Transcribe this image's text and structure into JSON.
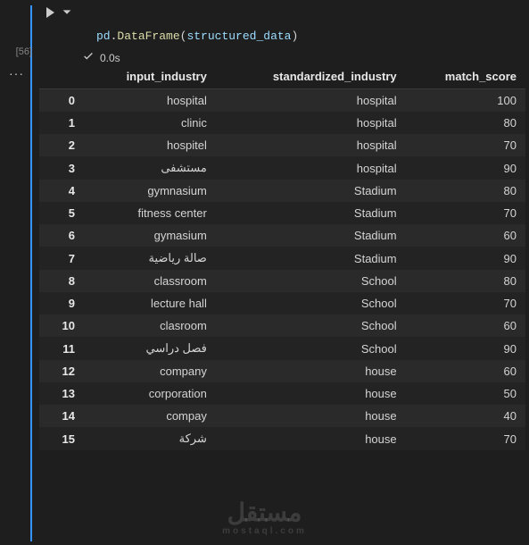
{
  "cell": {
    "exec_count": "[56]",
    "exec_time": "0.0s",
    "code": {
      "obj": "pd",
      "dot": ".",
      "func": "DataFrame",
      "open": "(",
      "var": "structured_data",
      "close": ")"
    }
  },
  "ellipsis": "···",
  "table": {
    "columns": [
      "input_industry",
      "standardized_industry",
      "match_score"
    ],
    "rows": [
      {
        "idx": "0",
        "input_industry": "hospital",
        "standardized_industry": "hospital",
        "match_score": "100"
      },
      {
        "idx": "1",
        "input_industry": "clinic",
        "standardized_industry": "hospital",
        "match_score": "80"
      },
      {
        "idx": "2",
        "input_industry": "hospitel",
        "standardized_industry": "hospital",
        "match_score": "70"
      },
      {
        "idx": "3",
        "input_industry": "مستشفى",
        "standardized_industry": "hospital",
        "match_score": "90"
      },
      {
        "idx": "4",
        "input_industry": "gymnasium",
        "standardized_industry": "Stadium",
        "match_score": "80"
      },
      {
        "idx": "5",
        "input_industry": "fitness center",
        "standardized_industry": "Stadium",
        "match_score": "70"
      },
      {
        "idx": "6",
        "input_industry": "gymasium",
        "standardized_industry": "Stadium",
        "match_score": "60"
      },
      {
        "idx": "7",
        "input_industry": "صالة رياضية",
        "standardized_industry": "Stadium",
        "match_score": "90"
      },
      {
        "idx": "8",
        "input_industry": "classroom",
        "standardized_industry": "School",
        "match_score": "80"
      },
      {
        "idx": "9",
        "input_industry": "lecture hall",
        "standardized_industry": "School",
        "match_score": "70"
      },
      {
        "idx": "10",
        "input_industry": "clasroom",
        "standardized_industry": "School",
        "match_score": "60"
      },
      {
        "idx": "11",
        "input_industry": "فصل دراسي",
        "standardized_industry": "School",
        "match_score": "90"
      },
      {
        "idx": "12",
        "input_industry": "company",
        "standardized_industry": "house",
        "match_score": "60"
      },
      {
        "idx": "13",
        "input_industry": "corporation",
        "standardized_industry": "house",
        "match_score": "50"
      },
      {
        "idx": "14",
        "input_industry": "compay",
        "standardized_industry": "house",
        "match_score": "40"
      },
      {
        "idx": "15",
        "input_industry": "شركة",
        "standardized_industry": "house",
        "match_score": "70"
      }
    ]
  },
  "watermark": {
    "main": "مستقل",
    "sub": "mostaql.com"
  },
  "chart_data": {
    "type": "table",
    "columns": [
      "input_industry",
      "standardized_industry",
      "match_score"
    ],
    "index": [
      0,
      1,
      2,
      3,
      4,
      5,
      6,
      7,
      8,
      9,
      10,
      11,
      12,
      13,
      14,
      15
    ],
    "rows": [
      [
        "hospital",
        "hospital",
        100
      ],
      [
        "clinic",
        "hospital",
        80
      ],
      [
        "hospitel",
        "hospital",
        70
      ],
      [
        "مستشفى",
        "hospital",
        90
      ],
      [
        "gymnasium",
        "Stadium",
        80
      ],
      [
        "fitness center",
        "Stadium",
        70
      ],
      [
        "gymasium",
        "Stadium",
        60
      ],
      [
        "صالة رياضية",
        "Stadium",
        90
      ],
      [
        "classroom",
        "School",
        80
      ],
      [
        "lecture hall",
        "School",
        70
      ],
      [
        "clasroom",
        "School",
        60
      ],
      [
        "فصل دراسي",
        "School",
        90
      ],
      [
        "company",
        "house",
        60
      ],
      [
        "corporation",
        "house",
        50
      ],
      [
        "compay",
        "house",
        40
      ],
      [
        "شركة",
        "house",
        70
      ]
    ]
  }
}
